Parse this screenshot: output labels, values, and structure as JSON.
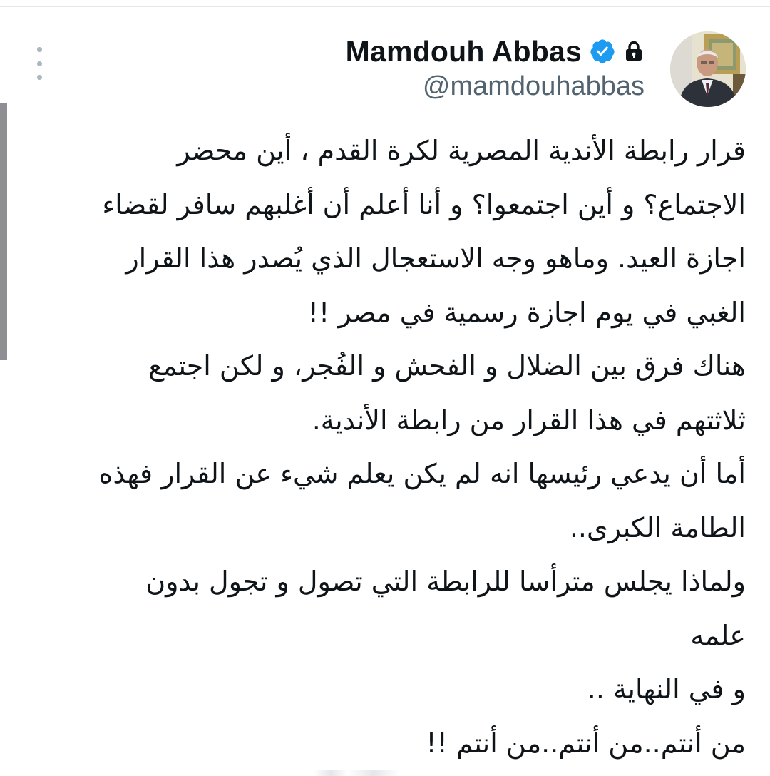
{
  "author": {
    "display_name": "Mamdouh Abbas",
    "handle": "@mamdouhabbas",
    "verified": true,
    "protected": true
  },
  "icons": {
    "more": "more-vertical-icon",
    "verified": "verified-badge-icon",
    "lock": "lock-icon",
    "accent_color": "#1d9bf0"
  },
  "tweet": {
    "lines": [
      "قرار رابطة الأندية المصرية لكرة القدم ، أين محضر",
      "الاجتماع؟ و أين اجتمعوا؟ و أنا أعلم أن أغلبهم سافر لقضاء",
      "اجازة العيد. وماهو وجه الاستعجال الذي يُصدر هذا القرار",
      "الغبي في يوم اجازة رسمية في مصر !!",
      "هناك فرق بين الضلال و الفحش و الفُجر، و لكن اجتمع",
      "ثلاثتهم في هذا القرار من رابطة الأندية.",
      "أما أن يدعي رئيسها انه لم يكن يعلم شيء عن القرار فهذه",
      "الطامة الكبرى..",
      "ولماذا يجلس مترأسا للرابطة التي تصول و تجول بدون",
      "علمه",
      "و في النهاية ..",
      "من أنتم..من أنتم..من أنتم !!"
    ]
  }
}
